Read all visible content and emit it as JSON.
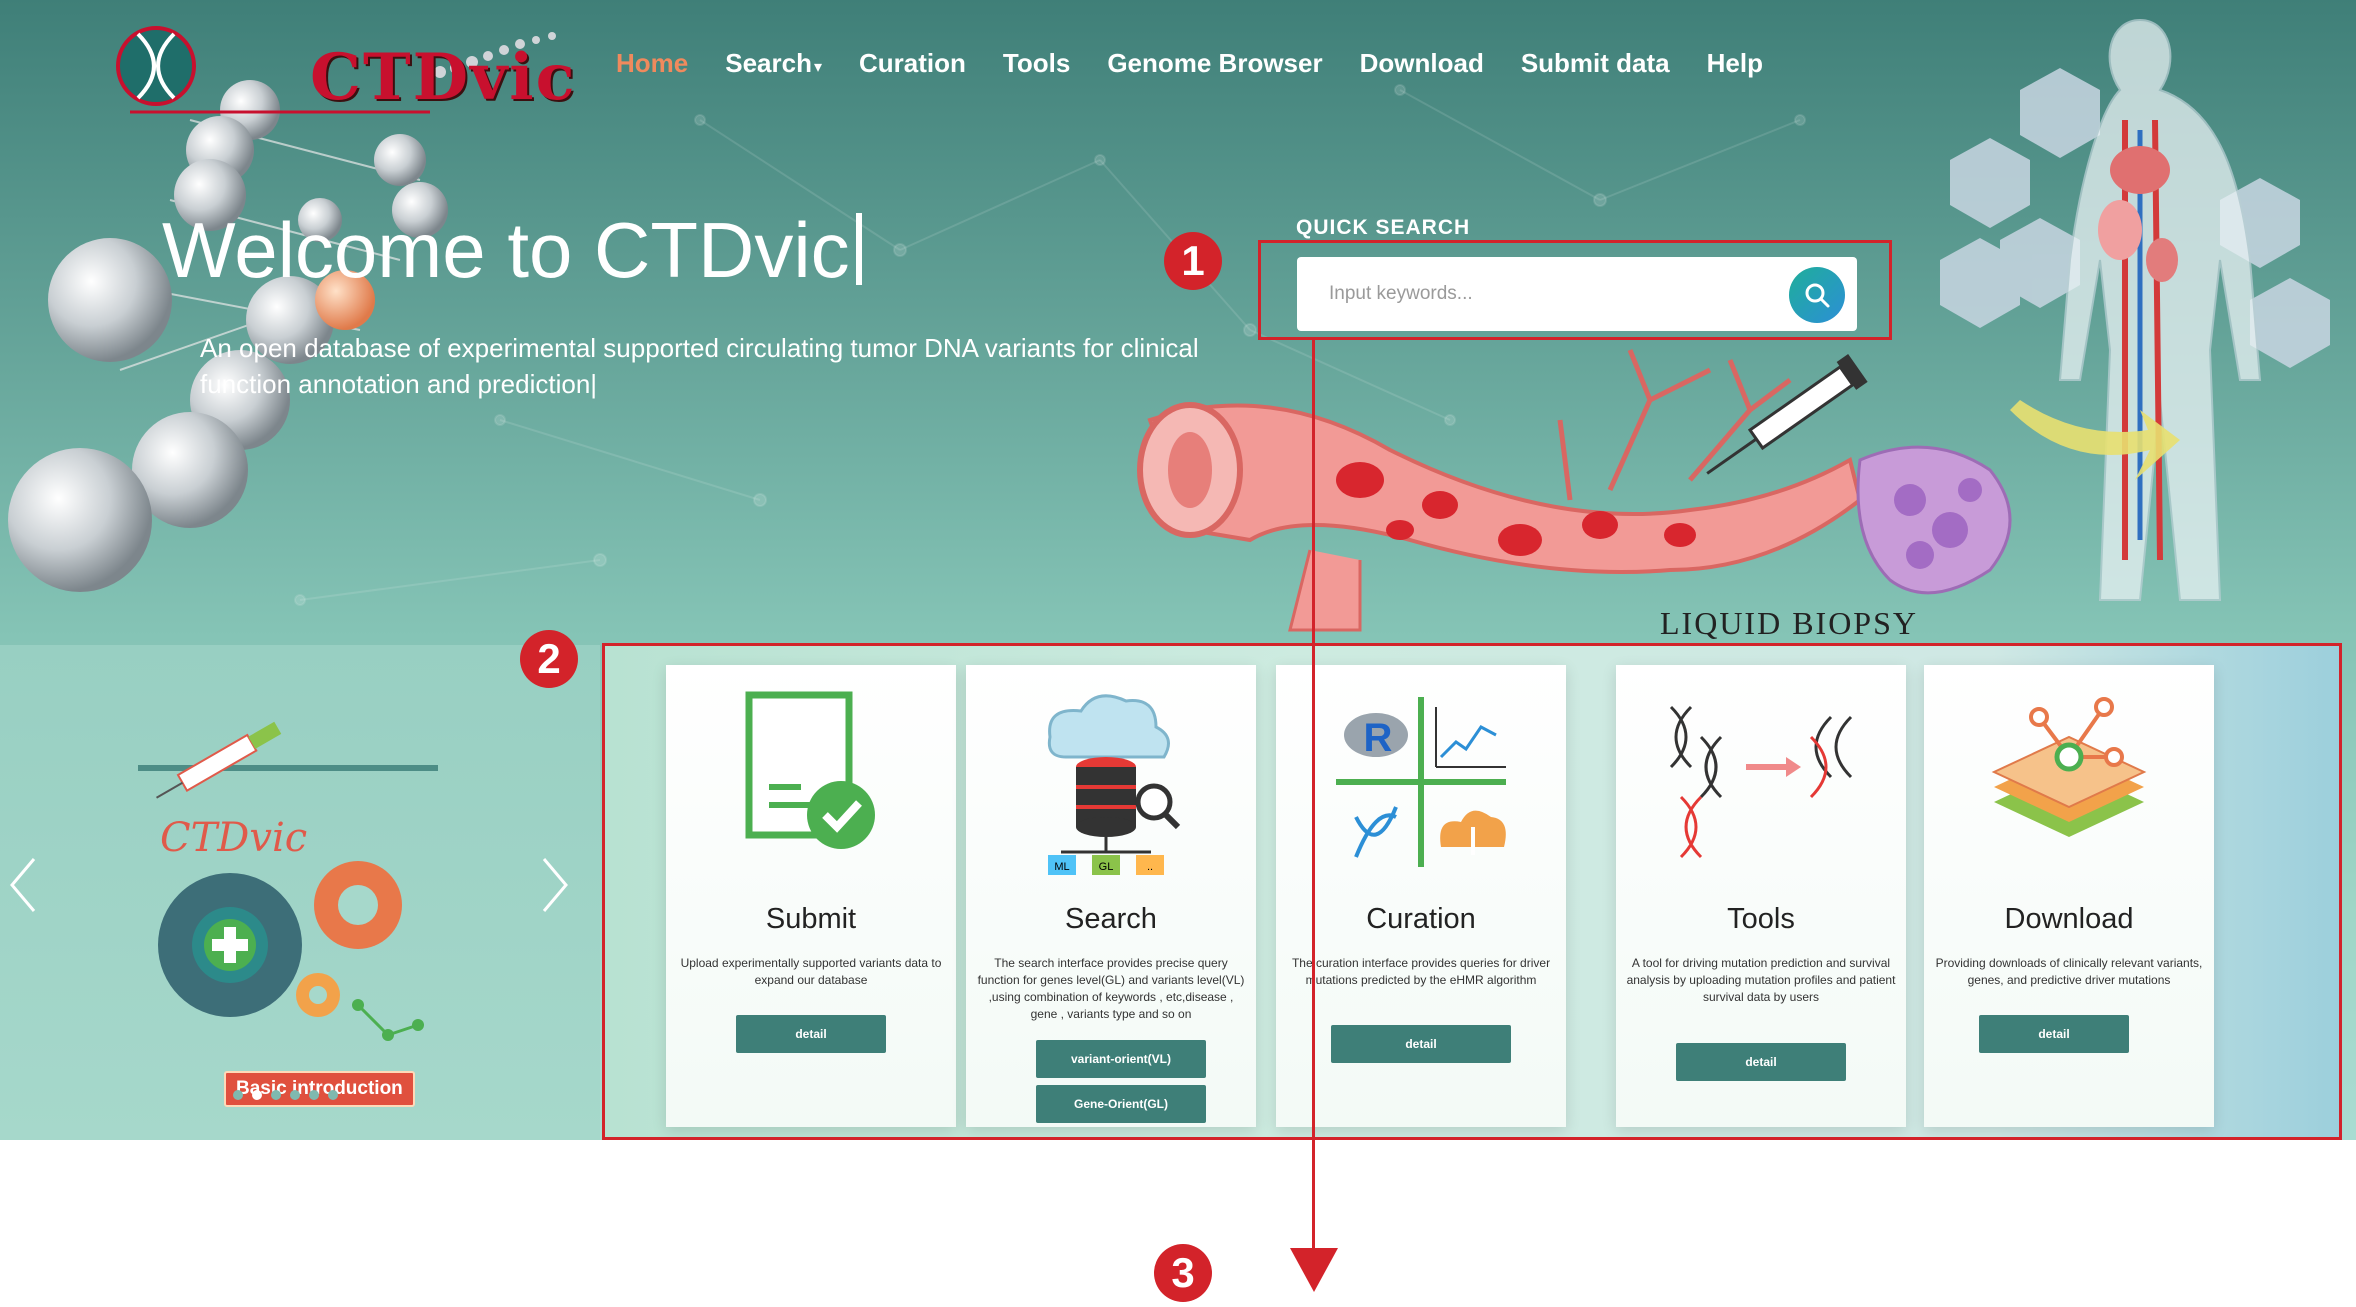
{
  "brand": {
    "logo_text": "CTDvic"
  },
  "nav": {
    "items": [
      "Home",
      "Search",
      "Curation",
      "Tools",
      "Genome Browser",
      "Download",
      "Submit data",
      "Help"
    ],
    "active": "Home",
    "search_caret": "▾"
  },
  "hero": {
    "title": "Welcome to CTDvic",
    "subtitle": "An open database of experimental supported circulating tumor DNA variants for clinical function annotation and prediction|",
    "illustration_caption": "LIQUID BIOPSY"
  },
  "quick_search": {
    "label": "QUICK SEARCH",
    "placeholder": "Input keywords..."
  },
  "banner": {
    "title": "CTDvic",
    "button": "Basic introduction",
    "dots": 6,
    "active_dot": 2
  },
  "cards": [
    {
      "title": "Submit",
      "desc": "Upload experimentally supported variants data to expand our database",
      "buttons": [
        "detail"
      ]
    },
    {
      "title": "Search",
      "desc": "The search interface provides precise query function for genes level(GL) and variants level(VL) ,using combination of keywords , etc,disease , gene , variants type and so on",
      "buttons": [
        "variant-orient(VL)",
        "Gene-Orient(GL)"
      ],
      "icon_tags": [
        "ML",
        "GL",
        ".."
      ]
    },
    {
      "title": "Curation",
      "desc": "The curation interface provides queries for driver mutations predicted by the eHMR algorithm",
      "buttons": [
        "detail"
      ],
      "icon_letter": "R"
    },
    {
      "title": "Tools",
      "desc": "A tool for driving mutation prediction and survival analysis by uploading mutation profiles and patient survival data by users",
      "buttons": [
        "detail"
      ]
    },
    {
      "title": "Download",
      "desc": "Providing downloads of clinically relevant variants, genes, and predictive driver mutations",
      "buttons": [
        "detail"
      ]
    }
  ],
  "annotations": [
    "1",
    "2",
    "3"
  ],
  "colors": {
    "accent_nav": "#f08a5d",
    "annotation_red": "#d3232a",
    "card_button": "#3e7f78",
    "logo_red": "#c8102e"
  }
}
